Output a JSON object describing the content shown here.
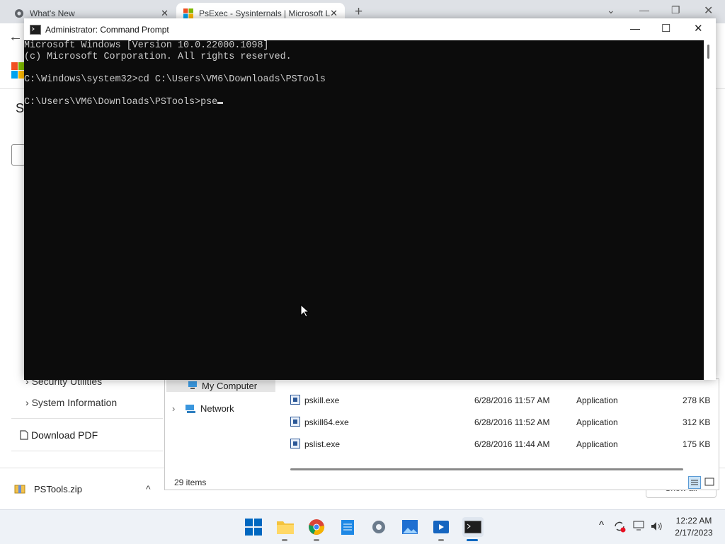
{
  "browser": {
    "tabs": [
      {
        "title": "What's New",
        "close": "✕"
      },
      {
        "title": "PsExec - Sysinternals | Microsoft Learn",
        "close": "✕"
      }
    ],
    "new_tab": "+",
    "window_controls": {
      "dropdown": "⌄",
      "minimize": "—",
      "restore": "❐",
      "close": "✕"
    }
  },
  "page": {
    "back": "←",
    "title_fragment": "S",
    "nav_items": [
      {
        "chevron": "›",
        "label": "Security Utilities"
      },
      {
        "chevron": "›",
        "label": "System Information"
      }
    ],
    "download_pdf": "Download PDF",
    "download_bar": {
      "file": "PSTools.zip",
      "chevron": "^",
      "show_all": "Show all"
    }
  },
  "explorer": {
    "nav": [
      {
        "label": "My Computer",
        "selected": true
      },
      {
        "label": "Network",
        "chevron": "›"
      }
    ],
    "files": [
      {
        "name": "pskill.exe",
        "date": "6/28/2016 11:57 AM",
        "type": "Application",
        "size": "278 KB"
      },
      {
        "name": "pskill64.exe",
        "date": "6/28/2016 11:52 AM",
        "type": "Application",
        "size": "312 KB"
      },
      {
        "name": "pslist.exe",
        "date": "6/28/2016 11:44 AM",
        "type": "Application",
        "size": "175 KB"
      }
    ],
    "status": "29 items"
  },
  "cmd": {
    "title": "Administrator: Command Prompt",
    "lines": [
      "Microsoft Windows [Version 10.0.22000.1098]",
      "(c) Microsoft Corporation. All rights reserved.",
      "",
      "C:\\Windows\\system32>cd C:\\Users\\VM6\\Downloads\\PSTools",
      "",
      "C:\\Users\\VM6\\Downloads\\PSTools>pse"
    ],
    "controls": {
      "minimize": "—",
      "maximize": "☐",
      "close": "✕"
    }
  },
  "taskbar": {
    "time": "12:22 AM",
    "date": "2/17/2023",
    "tray_chevron": "^"
  },
  "colors": {
    "accent": "#0067c0",
    "cmd_bg": "#0c0c0c",
    "cmd_fg": "#cccccc"
  }
}
